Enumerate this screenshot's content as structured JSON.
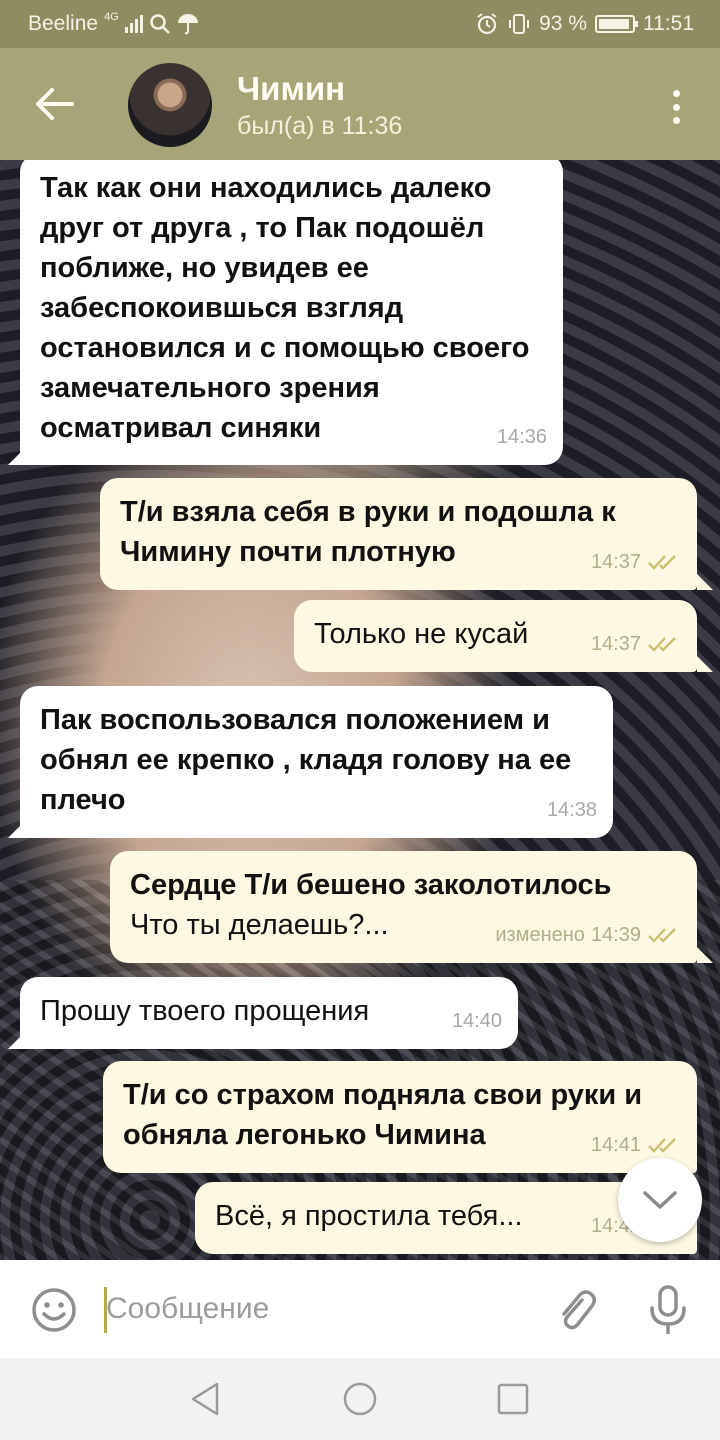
{
  "status_bar": {
    "carrier": "Beeline",
    "network": "4G",
    "battery": "93 %",
    "time": "11:51",
    "battery_level": 0.93
  },
  "header": {
    "contact_name": "Чимин",
    "last_seen": "был(а) в 11:36"
  },
  "messages": [
    {
      "direction": "in",
      "text": "Так как они находились далеко друг от друга , то Пак подошёл поближе, но увидев ее забеспокоившься взгляд остановился и с помощью своего замечательного зрения осматривал синяки",
      "time": "14:36"
    },
    {
      "direction": "out",
      "text": "Т/и взяла себя в руки и подошла к Чимину почти плотную",
      "time": "14:37",
      "read": true
    },
    {
      "direction": "out",
      "text": "Только не кусай",
      "time": "14:37",
      "read": true
    },
    {
      "direction": "in",
      "text": "Пак воспользовался положением и обнял ее крепко , кладя голову на ее плечо",
      "time": "14:38"
    },
    {
      "direction": "out",
      "text_bold": "Сердце Т/и бешено заколотилось",
      "text_normal": "Что ты делаешь?...",
      "time": "14:39",
      "edited_label": "изменено",
      "read": true
    },
    {
      "direction": "in",
      "text": "Прошу твоего прощения",
      "time": "14:40"
    },
    {
      "direction": "out",
      "text": "Т/и со страхом подняла свои руки и обняла легонько Чимина",
      "time": "14:41",
      "read": true
    },
    {
      "direction": "out",
      "text": "Всё, я простила тебя...",
      "time": "14:42",
      "read": true
    }
  ],
  "input": {
    "placeholder": "Сообщение"
  },
  "icons": {
    "back": "arrow-left-icon",
    "menu": "more-vert-icon",
    "emoji": "smiley-icon",
    "attach": "paperclip-icon",
    "mic": "microphone-icon",
    "scroll_down": "chevron-down-icon"
  },
  "colors": {
    "header": "#a7a578",
    "status_bar": "#8f8c62",
    "incoming_bubble": "#ffffff",
    "outgoing_bubble": "#fdf8e2",
    "checkmark": "#c9bf6e"
  }
}
